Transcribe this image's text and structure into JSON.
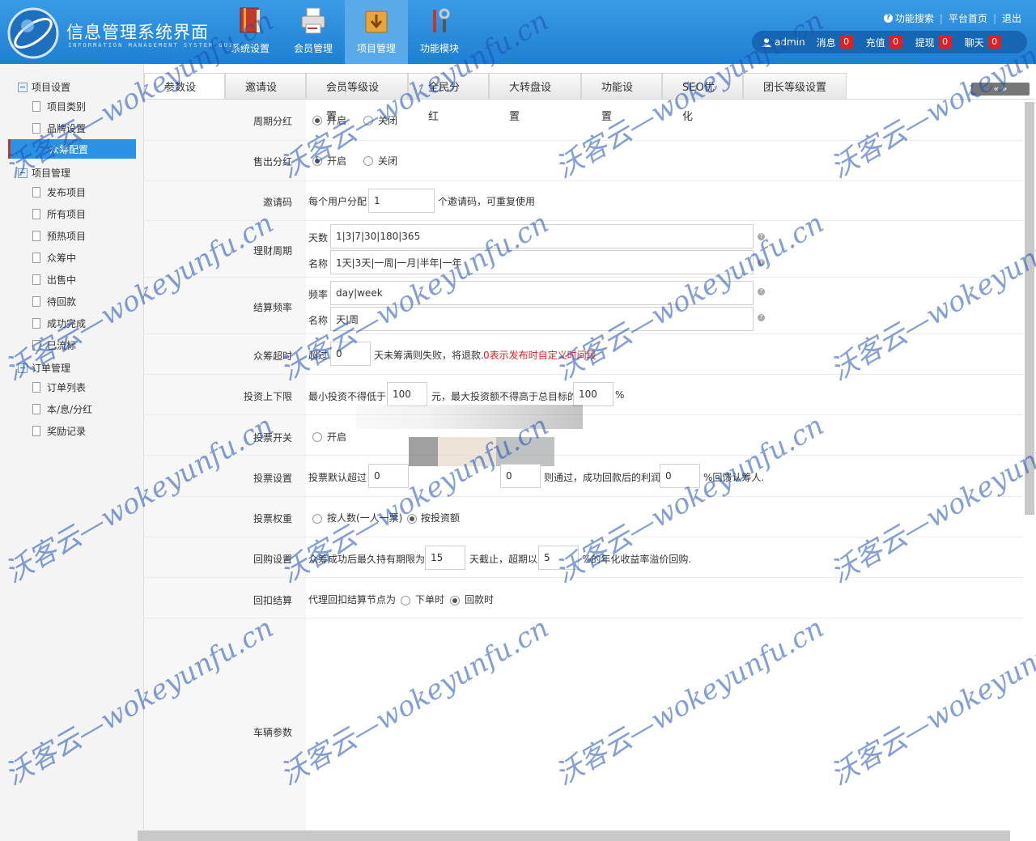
{
  "header": {
    "title": "信息管理系统界面",
    "subtitle": "INFORMATION MANAGEMENT SYSTEM GUI",
    "nav": [
      {
        "label": "系统设置",
        "icon": "book-icon"
      },
      {
        "label": "会员管理",
        "icon": "printer-icon"
      },
      {
        "label": "项目管理",
        "icon": "download-box-icon"
      },
      {
        "label": "功能模块",
        "icon": "tools-icon"
      }
    ],
    "links": {
      "search": "功能搜索",
      "home": "平台首页",
      "logout": "退出"
    },
    "user": {
      "name": "admin",
      "items": [
        {
          "label": "消息",
          "count": "0"
        },
        {
          "label": "充值",
          "count": "0"
        },
        {
          "label": "提现",
          "count": "0"
        },
        {
          "label": "聊天",
          "count": "0"
        }
      ]
    }
  },
  "sidebar": {
    "groups": [
      {
        "label": "项目设置",
        "items": [
          "项目类别",
          "品牌设置",
          "众筹配置"
        ]
      },
      {
        "label": "项目管理",
        "items": [
          "发布项目",
          "所有项目",
          "预热项目",
          "众筹中",
          "出售中",
          "待回款",
          "成功完成",
          "已流标"
        ]
      },
      {
        "label": "订单管理",
        "items": [
          "订单列表",
          "本/息/分红",
          "奖励记录"
        ]
      }
    ]
  },
  "tabs": [
    "参数设置",
    "邀请设置",
    "会员等级设置",
    "全民分红",
    "大转盘设置",
    "功能设置",
    "SEO优化",
    "团长等级设置"
  ],
  "tab_scroll": "« »",
  "form": {
    "periodic_dividend": {
      "label": "周期分红",
      "on": "开启",
      "off": "关闭"
    },
    "sale_dividend": {
      "label": "售出分红",
      "on": "开启",
      "off": "关闭"
    },
    "invite_code": {
      "label": "邀请码",
      "prefix": "每个用户分配",
      "value": "1",
      "suffix": "个邀请码，可重复使用"
    },
    "finance_period": {
      "label": "理财周期",
      "days_label": "天数",
      "days_value": "1|3|7|30|180|365",
      "name_label": "名称",
      "name_value": "1天|3天|一周|一月|半年|一年"
    },
    "settle_freq": {
      "label": "结算频率",
      "freq_label": "频率",
      "freq_value": "day|week",
      "name_label": "名称",
      "name_value": "天|周"
    },
    "crowdfund_timeout": {
      "label": "众筹超时",
      "prefix": "超过",
      "value": "0",
      "suffix": "天未筹满则失败，将退款.",
      "note": "0表示发布时自定义时间段"
    },
    "invest_limit": {
      "label": "投资上下限",
      "prefix": "最小投资不得低于",
      "min_value": "100",
      "middle": "元，最大投资额不得高于总目标的",
      "max_value": "100",
      "suffix": "%"
    },
    "vote_switch": {
      "label": "投票开关",
      "on": "开启"
    },
    "vote_setting": {
      "label": "投票设置",
      "prefix": "投票默认超过",
      "value1": "0",
      "value2": "0",
      "middle": "则通过，成功回款后的利润",
      "value3": "0",
      "suffix": "%回馈认筹人."
    },
    "vote_weight": {
      "label": "投票权重",
      "opt1": "按人数(一人一票)",
      "opt2": "按投资额"
    },
    "buyback": {
      "label": "回购设置",
      "prefix": "众筹成功后最久持有期限为",
      "value1": "15",
      "middle": "天截止，超期以",
      "value2": "5",
      "suffix": "%的年化收益率溢价回购."
    },
    "rebate_settle": {
      "label": "回扣结算",
      "prefix": "代理回扣结算节点为",
      "opt1": "下单时",
      "opt2": "回款时"
    },
    "vehicle_params": {
      "label": "车辆参数"
    }
  },
  "watermark": "沃客云—wokeyunfu.cn",
  "colors": {
    "header": "#2a8de0",
    "active_nav": "#5aa9e8",
    "badge": "#e02020",
    "sidebar_active": "#2a91e3"
  }
}
